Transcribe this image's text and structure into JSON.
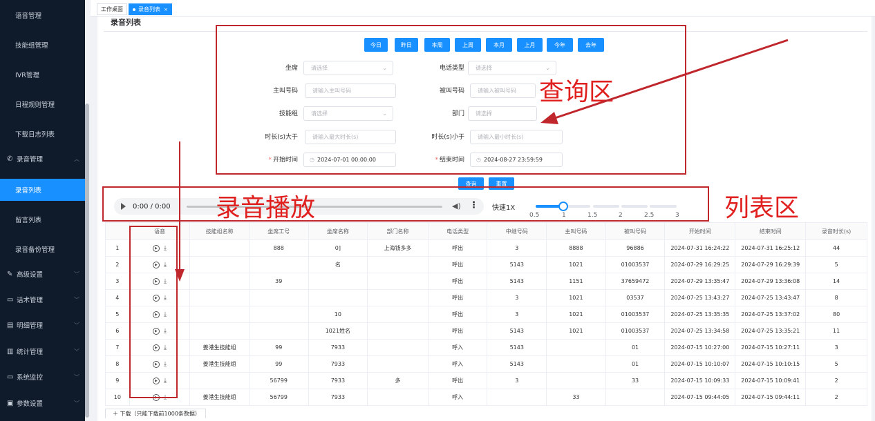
{
  "sidebar": {
    "items": [
      {
        "label": "语音管理",
        "type": "sub"
      },
      {
        "label": "技能组管理",
        "type": "sub"
      },
      {
        "label": "IVR管理",
        "type": "sub"
      },
      {
        "label": "日程规则管理",
        "type": "sub"
      },
      {
        "label": "下载日志列表",
        "type": "sub"
      },
      {
        "label": "录音管理",
        "type": "group",
        "icon": "phone-icon"
      },
      {
        "label": "录音列表",
        "type": "sub",
        "active": true
      },
      {
        "label": "留言列表",
        "type": "sub"
      },
      {
        "label": "录音备份管理",
        "type": "sub"
      },
      {
        "label": "高级设置",
        "type": "group",
        "icon": "pen-icon"
      },
      {
        "label": "话术管理",
        "type": "group",
        "icon": "chat-icon"
      },
      {
        "label": "明细管理",
        "type": "group",
        "icon": "list-icon"
      },
      {
        "label": "统计管理",
        "type": "group",
        "icon": "doc-icon"
      },
      {
        "label": "系统监控",
        "type": "group",
        "icon": "camera-icon"
      },
      {
        "label": "参数设置",
        "type": "group",
        "icon": "settings-icon"
      }
    ]
  },
  "tabs": {
    "home": "工作桌面",
    "current": "录音列表",
    "close": "×"
  },
  "page": {
    "title": "录音列表"
  },
  "quick_dates": [
    "今日",
    "昨日",
    "本周",
    "上周",
    "本月",
    "上月",
    "今年",
    "去年"
  ],
  "form": {
    "seat_label": "坐席",
    "seat_placeholder": "请选择",
    "calltype_label": "电话类型",
    "calltype_placeholder": "请选择",
    "caller_label": "主叫号码",
    "caller_placeholder": "请输入主叫号码",
    "callee_label": "被叫号码",
    "callee_placeholder": "请输入被叫号码",
    "skill_label": "技能组",
    "skill_placeholder": "请选择",
    "dept_label": "部门",
    "dept_placeholder": "请选择",
    "dur_gt_label": "时长(s)大于",
    "dur_gt_placeholder": "请输入最大时长(s)",
    "dur_lt_label": "时长(s)小于",
    "dur_lt_placeholder": "请输入最小时长(s)",
    "start_label": "开始时间",
    "start_value": "2024-07-01 00:00:00",
    "end_label": "结束时间",
    "end_value": "2024-08-27 23:59:59",
    "required_mark": "*",
    "search_btn": "查询",
    "reset_btn": "重置"
  },
  "player": {
    "time": "0:00 / 0:00",
    "speed_label": "快速1X",
    "marks": [
      "0.5",
      "1",
      "1.5",
      "2",
      "2.5",
      "3"
    ],
    "speed_value": 1
  },
  "annotations": {
    "query": "查询区",
    "playback": "录音播放",
    "list": "列表区"
  },
  "table": {
    "headers": [
      "",
      "语音",
      "技能组名称",
      "坐席工号",
      "坐席名称",
      "部门名称",
      "电话类型",
      "中继号码",
      "主叫号码",
      "被叫号码",
      "开始时间",
      "结束时间",
      "录音时长(s)"
    ],
    "rows": [
      [
        "1",
        "",
        "",
        "888",
        "0]",
        "上海钱多多",
        "呼出",
        "3",
        "8888",
        "96886",
        "2024-07-31 16:24:22",
        "2024-07-31 16:25:12",
        "44"
      ],
      [
        "2",
        "",
        "",
        "",
        "名",
        "",
        "呼出",
        "5143",
        "1021",
        "01003537",
        "2024-07-29 16:29:25",
        "2024-07-29 16:29:39",
        "5"
      ],
      [
        "3",
        "",
        "",
        "39",
        "",
        "",
        "呼出",
        "5143",
        "1151",
        "37659472",
        "2024-07-29 13:35:47",
        "2024-07-29 13:36:08",
        "14"
      ],
      [
        "4",
        "",
        "",
        "",
        "",
        "",
        "呼出",
        "3",
        "1021",
        "03537",
        "2024-07-25 13:43:27",
        "2024-07-25 13:43:47",
        "8"
      ],
      [
        "5",
        "",
        "",
        "",
        "10",
        "",
        "呼出",
        "3",
        "1021",
        "01003537",
        "2024-07-25 13:35:35",
        "2024-07-25 13:37:02",
        "80"
      ],
      [
        "6",
        "",
        "",
        "",
        "1021姓名",
        "",
        "呼出",
        "5143",
        "1021",
        "01003537",
        "2024-07-25 13:34:58",
        "2024-07-25 13:35:21",
        "11"
      ],
      [
        "7",
        "",
        "姜港生技能组",
        "99",
        "7933",
        "",
        "呼入",
        "5143",
        "",
        "01",
        "2024-07-15 10:27:00",
        "2024-07-15 10:27:11",
        "3"
      ],
      [
        "8",
        "",
        "姜港生技能组",
        "99",
        "7933",
        "",
        "呼入",
        "5143",
        "",
        "01",
        "2024-07-15 10:10:07",
        "2024-07-15 10:10:15",
        "5"
      ],
      [
        "9",
        "",
        "",
        "56799",
        "7933",
        "多",
        "呼出",
        "3",
        "",
        "33",
        "2024-07-15 10:09:33",
        "2024-07-15 10:09:41",
        "2"
      ],
      [
        "10",
        "",
        "姜港生技能组",
        "56799",
        "7933",
        "",
        "呼入",
        "",
        "33",
        "",
        "2024-07-15 09:44:05",
        "2024-07-15 09:44:11",
        "2"
      ]
    ]
  },
  "footer": {
    "download": "下载（只能下载前1000条数据）"
  }
}
